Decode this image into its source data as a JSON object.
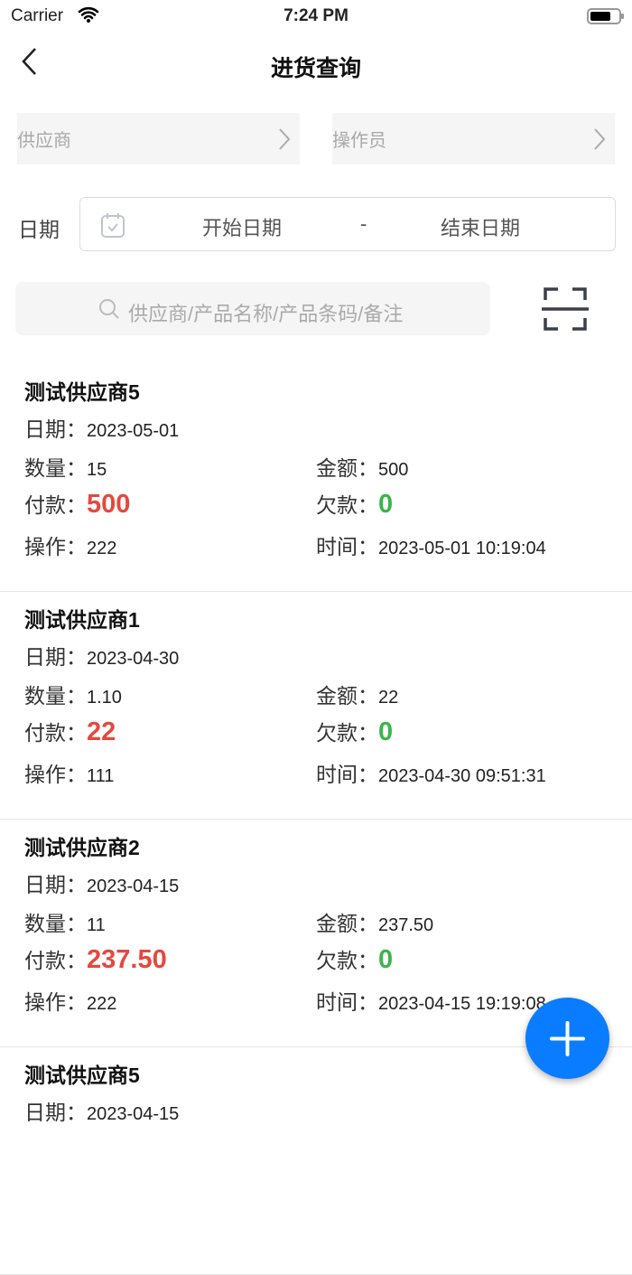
{
  "status": {
    "carrier": "Carrier",
    "time": "7:24 PM"
  },
  "header": {
    "title": "进货查询"
  },
  "filters": {
    "supplier_placeholder": "供应商",
    "operator_placeholder": "操作员",
    "date_label": "日期",
    "start_date": "开始日期",
    "separator": "-",
    "end_date": "结束日期",
    "search_placeholder": "供应商/产品名称/产品条码/备注"
  },
  "labels": {
    "date": "日期：",
    "qty": "数量：",
    "amount": "金额：",
    "paid": "付款：",
    "owed": "欠款：",
    "operator": "操作：",
    "time": "时间："
  },
  "records": [
    {
      "name": "测试供应商5",
      "date": "2023-05-01",
      "qty": "15",
      "amount": "500",
      "paid": "500",
      "owed": "0",
      "operator": "222",
      "time": "2023-05-01 10:19:04"
    },
    {
      "name": "测试供应商1",
      "date": "2023-04-30",
      "qty": "1.10",
      "amount": "22",
      "paid": "22",
      "owed": "0",
      "operator": "111",
      "time": "2023-04-30 09:51:31"
    },
    {
      "name": "测试供应商2",
      "date": "2023-04-15",
      "qty": "11",
      "amount": "237.50",
      "paid": "237.50",
      "owed": "0",
      "operator": "222",
      "time": "2023-04-15 19:19:08"
    },
    {
      "name": "测试供应商5",
      "date": "2023-04-15"
    }
  ],
  "colors": {
    "accent": "#0a7cff",
    "paid": "#e5483e",
    "owed": "#3bb54a"
  }
}
